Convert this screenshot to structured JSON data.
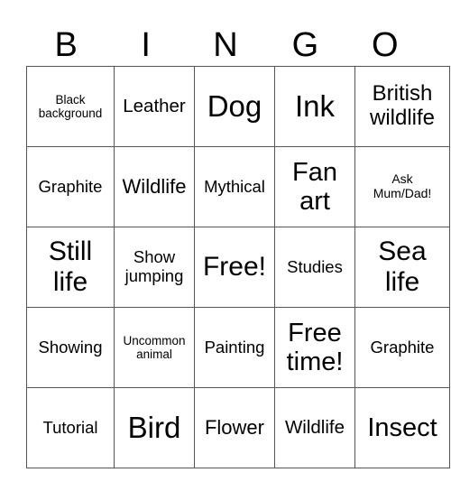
{
  "header": [
    "B",
    "I",
    "N",
    "G",
    "O"
  ],
  "rows": [
    [
      "Black background",
      "Leather",
      "Dog",
      "Ink",
      "British wildlife"
    ],
    [
      "Graphite",
      "Wildlife",
      "Mythical",
      "Fan art",
      "Ask Mum/Dad!"
    ],
    [
      "Still life",
      "Show jumping",
      "Free!",
      "Studies",
      "Sea life"
    ],
    [
      "Showing",
      "Uncommon animal",
      "Painting",
      "Free time!",
      "Graphite"
    ],
    [
      "Tutorial",
      "Bird",
      "Flower",
      "Wildlife",
      "Insect"
    ]
  ]
}
